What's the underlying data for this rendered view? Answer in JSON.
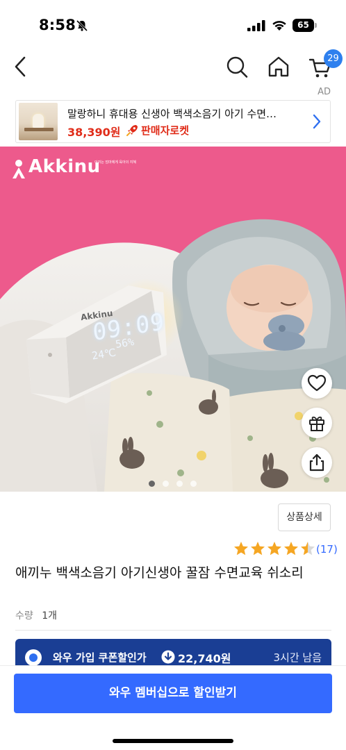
{
  "status_bar": {
    "time": "8:58",
    "battery": "65"
  },
  "nav": {
    "cart_count": "29"
  },
  "ad": {
    "label": "AD",
    "title": "말랑하니 휴대용 신생아 백색소음기 아기 수면…",
    "price": "38,390원",
    "seller": "판매자로켓"
  },
  "hero": {
    "brand": "Akkinu",
    "brand_tagline": "아끼는 엄마에게 육아의 지혜",
    "clock_brand": "Akkinu",
    "clock_time": "09:09",
    "clock_temp": "24℃",
    "clock_humidity": "56%",
    "dots_count": 4,
    "active_dot": 0
  },
  "product": {
    "detail_button": "상품상세",
    "rating": 4.5,
    "review_count": "(17)",
    "title": "애끼누 백색소음기 아기신생아 꿀잠 수면교육 쉬소리",
    "qty_label": "수량",
    "qty_value": "1개"
  },
  "coupon": {
    "label": "와우 가입 쿠폰할인가",
    "price": "22,740원",
    "time_left": "3시간 남음"
  },
  "cta": {
    "label": "와우 멤버십으로 할인받기"
  },
  "colors": {
    "accent_blue": "#346aff",
    "coupon_navy": "#1a3e94",
    "price_red": "#e02c19",
    "hero_pink": "#ed5a8c",
    "star_gold": "#f5a623"
  },
  "icons": [
    "bell-slash-icon",
    "signal-icon",
    "wifi-icon",
    "back-icon",
    "search-icon",
    "home-icon",
    "cart-icon",
    "rocket-icon",
    "chevron-right-icon",
    "heart-icon",
    "gift-icon",
    "share-icon",
    "star-icon",
    "download-icon"
  ]
}
